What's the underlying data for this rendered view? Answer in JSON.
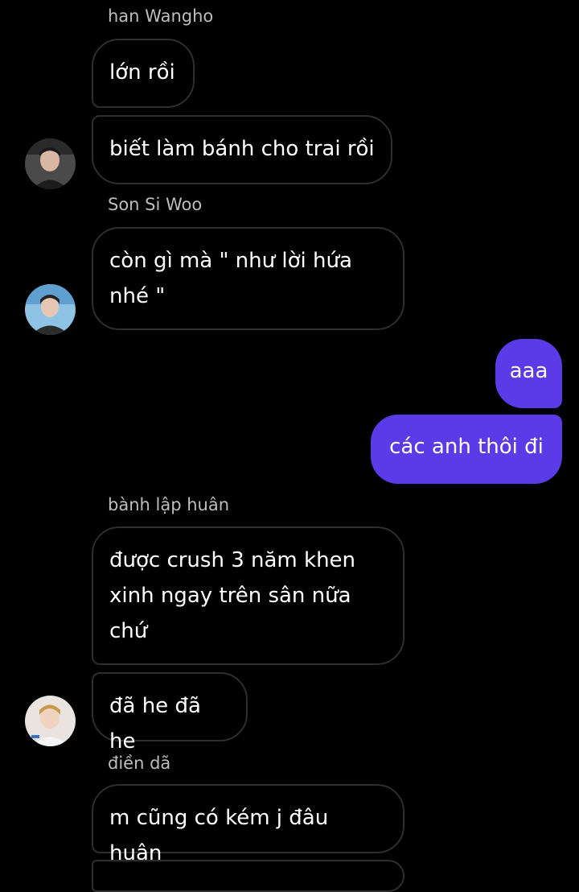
{
  "colors": {
    "background": "#000000",
    "incoming_border": "#2e2e2e",
    "outgoing_bubble": "#5b3be8",
    "sender_name": "#bdbdbd"
  },
  "messages": {
    "g1": {
      "sender": "han Wangho",
      "m1": "lớn rồi",
      "m2": "biết làm bánh cho trai rồi"
    },
    "g2": {
      "sender": "Son Si Woo",
      "m1_line1": "còn gì mà \" như lời hứa",
      "m1_line2": "nhé \""
    },
    "out": {
      "m1": "aaa",
      "m2": "các anh thôi đi"
    },
    "g3": {
      "sender": "bành lập huân",
      "m1_line1": "được crush 3 năm khen",
      "m1_line2": "xinh ngay trên sân nữa",
      "m1_line3": "chứ",
      "m2": "đã he đã he"
    },
    "g4": {
      "sender": "điền dã",
      "m1": "m cũng có kém j đâu huân"
    }
  }
}
